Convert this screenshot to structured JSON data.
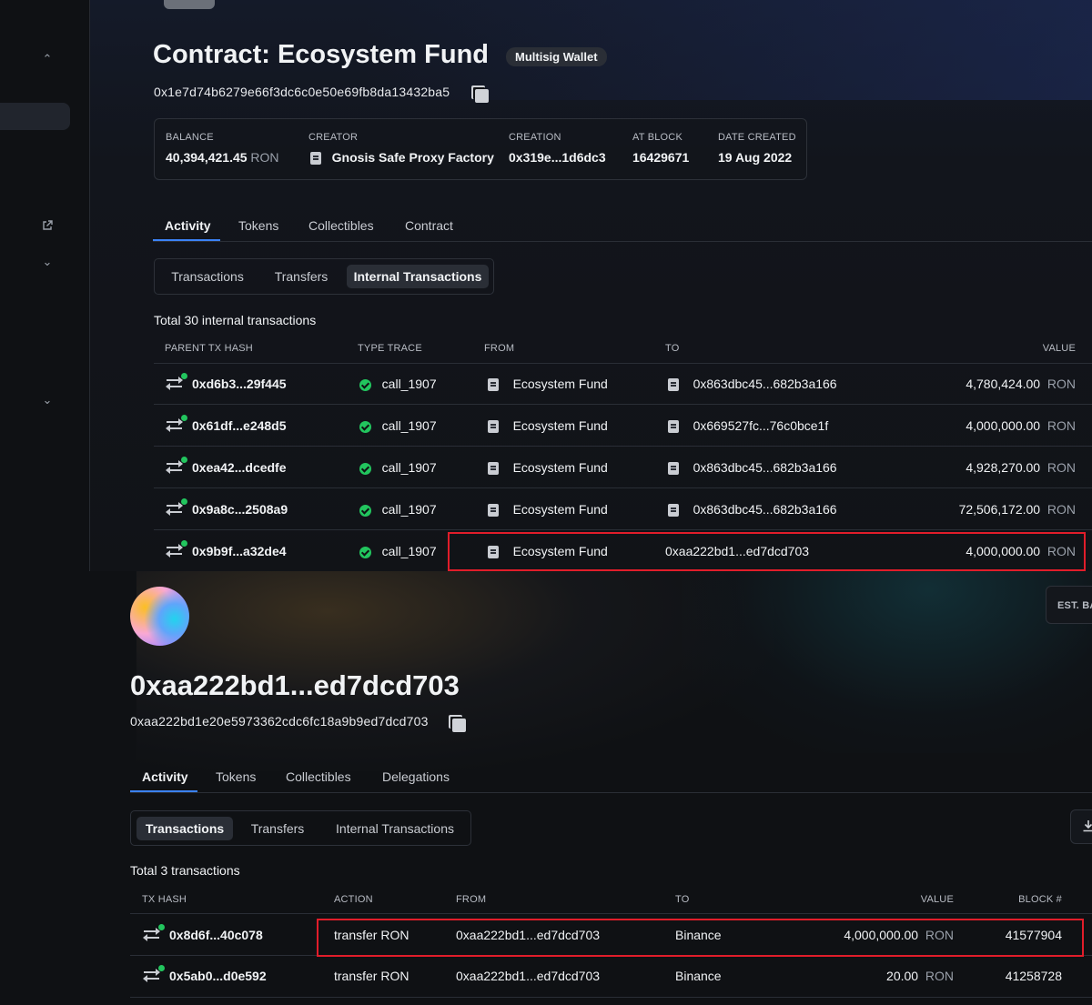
{
  "contract": {
    "title": "Contract: Ecosystem Fund",
    "badge": "Multisig Wallet",
    "address": "0x1e7d74b6279e66f3dc6c0e50e69fb8da13432ba5",
    "stats": [
      {
        "label": "BALANCE",
        "value": "40,394,421.45",
        "unit": "RON"
      },
      {
        "label": "CREATOR",
        "value": "Gnosis Safe Proxy Factory"
      },
      {
        "label": "CREATION",
        "value": "0x319e...1d6dc3"
      },
      {
        "label": "AT BLOCK",
        "value": "16429671"
      },
      {
        "label": "DATE CREATED",
        "value": "19 Aug 2022"
      }
    ],
    "tabs": [
      "Activity",
      "Tokens",
      "Collectibles",
      "Contract"
    ],
    "subtabs": [
      "Transactions",
      "Transfers",
      "Internal Transactions"
    ],
    "total": "Total 30 internal transactions",
    "columns": [
      "PARENT TX HASH",
      "TYPE TRACE",
      "FROM",
      "TO",
      "VALUE"
    ],
    "rows": [
      {
        "hash": "0xd6b3...29f445",
        "trace": "call_1907",
        "from": "Ecosystem Fund",
        "to": "0x863dbc45...682b3a166",
        "value": "4,780,424.00",
        "unit": "RON"
      },
      {
        "hash": "0x61df...e248d5",
        "trace": "call_1907",
        "from": "Ecosystem Fund",
        "to": "0x669527fc...76c0bce1f",
        "value": "4,000,000.00",
        "unit": "RON"
      },
      {
        "hash": "0xea42...dcedfe",
        "trace": "call_1907",
        "from": "Ecosystem Fund",
        "to": "0x863dbc45...682b3a166",
        "value": "4,928,270.00",
        "unit": "RON"
      },
      {
        "hash": "0x9a8c...2508a9",
        "trace": "call_1907",
        "from": "Ecosystem Fund",
        "to": "0x863dbc45...682b3a166",
        "value": "72,506,172.00",
        "unit": "RON"
      },
      {
        "hash": "0x9b9f...a32de4",
        "trace": "call_1907",
        "from": "Ecosystem Fund",
        "to": "0xaa222bd1...ed7dcd703",
        "value": "4,000,000.00",
        "unit": "RON"
      }
    ]
  },
  "wallet": {
    "title": "0xaa222bd1...ed7dcd703",
    "address": "0xaa222bd1e20e5973362cdc6fc18a9b9ed7dcd703",
    "est_label": "EST. BA",
    "tabs": [
      "Activity",
      "Tokens",
      "Collectibles",
      "Delegations"
    ],
    "subtabs": [
      "Transactions",
      "Transfers",
      "Internal Transactions"
    ],
    "total": "Total 3 transactions",
    "columns": [
      "TX HASH",
      "ACTION",
      "FROM",
      "TO",
      "VALUE",
      "BLOCK #"
    ],
    "rows": [
      {
        "hash": "0x8d6f...40c078",
        "action": "transfer RON",
        "from": "0xaa222bd1...ed7dcd703",
        "to": "Binance",
        "value": "4,000,000.00",
        "unit": "RON",
        "block": "41577904"
      },
      {
        "hash": "0x5ab0...d0e592",
        "action": "transfer RON",
        "from": "0xaa222bd1...ed7dcd703",
        "to": "Binance",
        "value": "20.00",
        "unit": "RON",
        "block": "41258728"
      }
    ]
  },
  "colors": {
    "accent": "#3b82f6",
    "success": "#22c55e",
    "highlight": "#e11d2a"
  },
  "icons": [
    "chevron-up-icon",
    "external-link-icon",
    "chevron-down-icon",
    "copy-icon",
    "document-icon",
    "transfer-icon",
    "check-circle-icon",
    "download-icon"
  ]
}
